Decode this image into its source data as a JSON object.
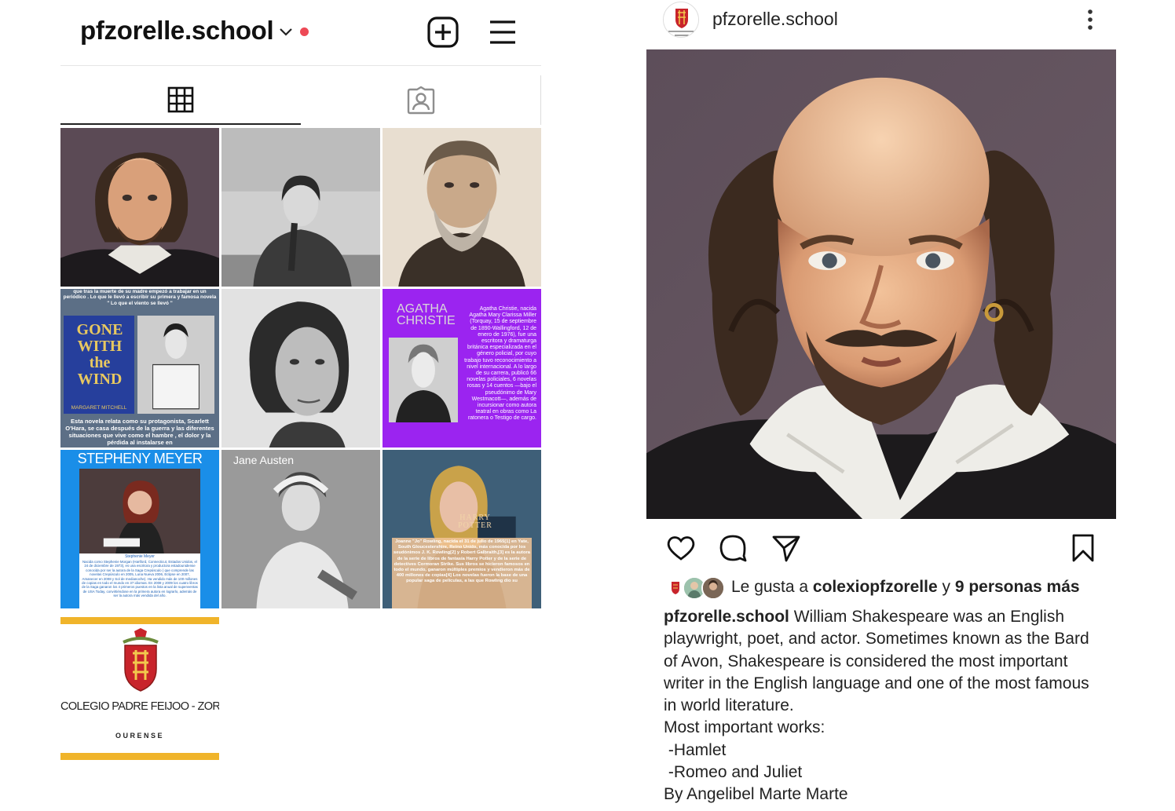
{
  "profile": {
    "username": "pfzorelle.school",
    "tabs": [
      {
        "name": "grid",
        "icon": "grid-icon"
      },
      {
        "name": "tagged",
        "icon": "tagged-person-icon"
      }
    ],
    "accent_color": "#ed4956"
  },
  "grid_posts": [
    {
      "subject": "William Shakespeare portrait",
      "text": ""
    },
    {
      "subject": "Woman writer black and white photo",
      "text": ""
    },
    {
      "subject": "Charles Dickens portrait",
      "text": ""
    },
    {
      "subject": "Gone with the Wind",
      "top_text": "que tras la muerte de su madre empezó a trabajar en un periódico . Lo que le llevó a escribir su primera y famosa novela \" Lo que el viento se llevó \"",
      "book_title": "GONE WITH the WIND",
      "book_author": "MARGARET MITCHELL",
      "bottom_text": "Esta novela relata como su protagonista, Scarlett O'Hara, se casa después de la guerra y las diferentes situaciones que vive como el hambre , el dolor y la pérdida al instalarse en"
    },
    {
      "subject": "Virginia Woolf portrait",
      "text": ""
    },
    {
      "subject": "Agatha Christie",
      "title": "AGATHA CHRISTIE",
      "text": "Agatha Christie, nacida Agatha Mary Clarissa Miller (Torquay, 15 de septiembre de 1890-Wallingford, 12 de enero de 1976), fue una escritora y dramaturga británica especializada en el género policial, por cuyo trabajo tuvo reconocimiento a nivel internacional. A lo largo de su carrera, publicó 66 novelas policiales, 6 novelas rosas y 14 cuentos —bajo el pseudónimo de Mary Westmacott—, además de incursionar como autora teatral en obras como La ratonera o Testigo de cargo."
    },
    {
      "subject": "Stepheny Meyer",
      "title": "STEPHENY MEYER",
      "photo_caption": "Stephenie Meyer",
      "text": "Nacida como Stephenie Morgan (Hartford, Connecticut, Estados Unidos, el 24 de diciembre de 1973), es una escritora y productora estadounidense conocida por ser la autora de la Saga Crepúsculo ( que comprende las novelas Crepúsculo en 2005, Luna Nueva 2006, Eclipse en 2007, Amanecer en 2008 y Sol de medianoche). Ha vendido más de 100 millones de copias en todo el mundo en 37 idiomas. En 2008 y 2009 los cuatro libros de la Saga ganaron los 4 primeros puestos en la lista anual de supenventas de USA Today, convirtiéndose en la primera autora en lograrlo, además de ser la autora más vendida del año."
    },
    {
      "subject": "Jane Austen",
      "title": "Jane Austen"
    },
    {
      "subject": "J.K. Rowling",
      "book": "HARRY POTTER",
      "text": "Joanne \"Jo\" Rowling, nacida el 31 de julio de 1965[1] en Yate, South Gloucestershire, Reino Unido, más conocida por los seudónimos J. K. Rowling[2] y Robert Galbraith,[3] es la autora de la serie de libros de fantasía Harry Potter y de la serie de detectives Cormoran Strike. Sus libros se hicieron famosos en todo el mundo, ganaron múltiples premios y vendieron más de 400 millones de copias[4] Los novelas fueron la base de una popular saga de películas, a las que Rowling dio su"
    },
    {
      "subject": "School logo",
      "name": "COLEGIO PADRE FEIJOO - ZORELL",
      "city": "OURENSE"
    }
  ],
  "post": {
    "username": "pfzorelle.school",
    "avatar_text": "O PADRE FEIJOO - Z OURENSE",
    "likes": {
      "prefix": "Le gusta a ",
      "liker": "colexiopfzorelle",
      "connector": " y ",
      "others": "9 personas más"
    },
    "caption_lines": [
      "William Shakespeare was an English",
      "playwright, poet, and actor. Sometimes known as the Bard",
      "of Avon, Shakespeare is considered the most important",
      "writer in the English language and one of the most famous",
      "in world literature.",
      "Most important works:",
      " -Hamlet",
      " -Romeo and Juliet",
      "By Angelibel Marte Marte"
    ]
  }
}
